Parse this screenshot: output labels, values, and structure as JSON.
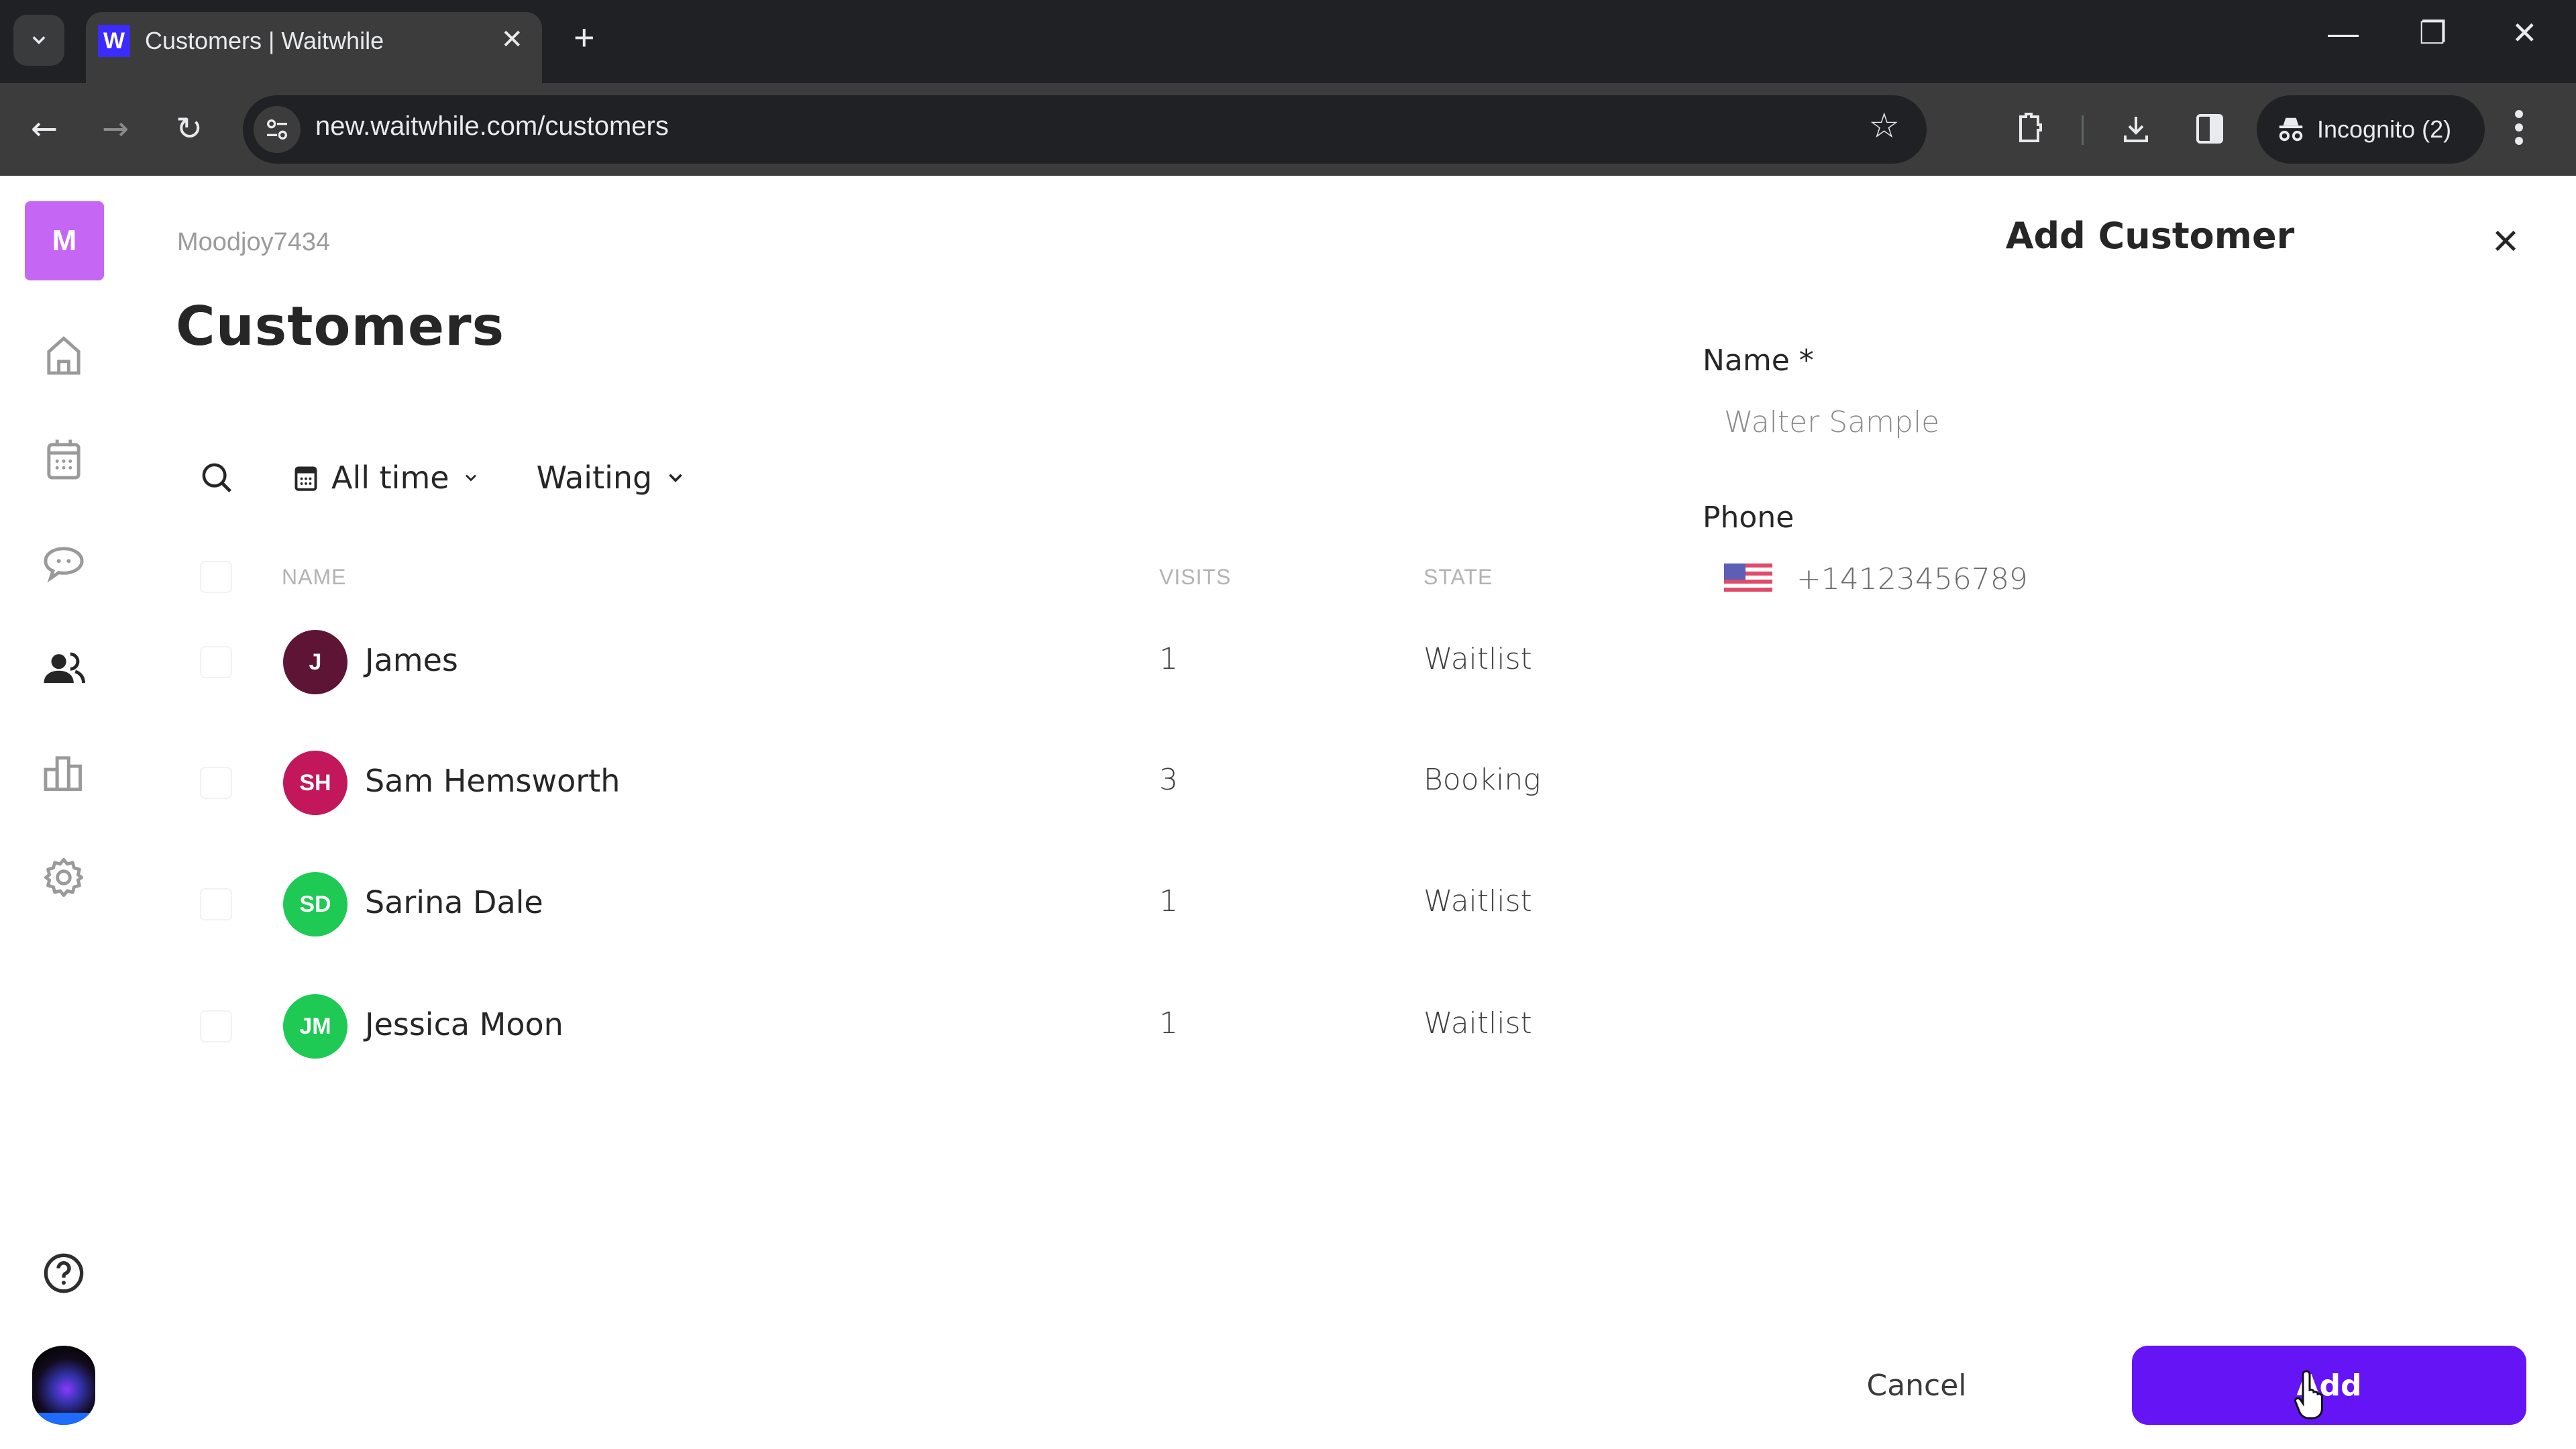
{
  "browser": {
    "tab_title": "Customers | Waitwhile",
    "favicon_letter": "W",
    "url": "new.waitwhile.com/customers",
    "profile_label": "Incognito (2)"
  },
  "app": {
    "logo_letter": "M",
    "brand_color": "#c567f4",
    "accent_color": "#6514f5",
    "sidebar": {
      "items": [
        {
          "name": "home",
          "icon": "home-icon",
          "active": false
        },
        {
          "name": "calendar",
          "icon": "calendar-icon",
          "active": false
        },
        {
          "name": "messages",
          "icon": "chat-icon",
          "active": false
        },
        {
          "name": "customers",
          "icon": "users-icon",
          "active": true
        },
        {
          "name": "analytics",
          "icon": "bar-chart-icon",
          "active": false
        },
        {
          "name": "settings",
          "icon": "gear-icon",
          "active": false
        }
      ],
      "help_icon": "help-icon"
    },
    "breadcrumb": "Moodjoy7434",
    "page_title": "Customers",
    "filters": {
      "time_label": "All time",
      "state_label": "Waiting"
    },
    "table": {
      "columns": [
        "NAME",
        "VISITS",
        "STATE"
      ],
      "rows": [
        {
          "initials": "J",
          "name": "James",
          "visits": "1",
          "state": "Waitlist",
          "avatar_color": "#5e1535"
        },
        {
          "initials": "SH",
          "name": "Sam Hemsworth",
          "visits": "3",
          "state": "Booking",
          "avatar_color": "#c2185b"
        },
        {
          "initials": "SD",
          "name": "Sarina Dale",
          "visits": "1",
          "state": "Waitlist",
          "avatar_color": "#1ec954"
        },
        {
          "initials": "JM",
          "name": "Jessica Moon",
          "visits": "1",
          "state": "Waitlist",
          "avatar_color": "#1ec954"
        }
      ]
    }
  },
  "panel": {
    "title": "Add Customer",
    "name_label": "Name *",
    "name_value": "Walter Sample",
    "phone_label": "Phone",
    "phone_country": "US",
    "phone_value": "+14123456789",
    "cancel_label": "Cancel",
    "add_label": "Add"
  }
}
